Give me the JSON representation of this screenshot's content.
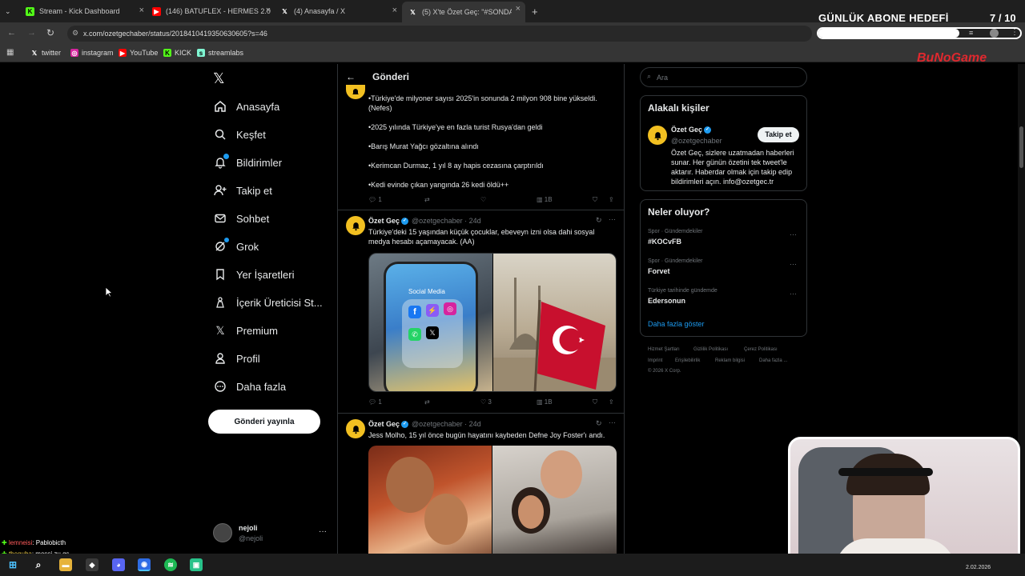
{
  "browser": {
    "tabs": [
      {
        "title": "Stream - Kick Dashboard",
        "icon": "kick-icon"
      },
      {
        "title": "(146) BATUFLEX - HERMES 2.0",
        "icon": "youtube-icon"
      },
      {
        "title": "(4) Anasayfa / X",
        "icon": "x-icon"
      },
      {
        "title": "(5) X'te Özet Geç: \"#SONDAKİK",
        "icon": "x-icon"
      }
    ],
    "url": "x.com/ozetgechaber/status/2018410419350630605?s=46",
    "bookmarks": [
      "twitter",
      "instagram",
      "YouTube",
      "KICK",
      "streamlabs"
    ]
  },
  "overlay": {
    "goal_title": "GÜNLÜK ABONE HEDEFİ",
    "goal_count": "7",
    "goal_total": "/ 10",
    "goal_progress": 0.7,
    "logo": "BuNoGame"
  },
  "nav": {
    "items": [
      "Anasayfa",
      "Keşfet",
      "Bildirimler",
      "Takip et",
      "Sohbet",
      "Grok",
      "Yer İşaretleri",
      "İçerik Üreticisi St...",
      "Premium",
      "Profil",
      "Daha fazla"
    ],
    "post_button": "Gönderi yayınla",
    "user_name": "nejoli",
    "user_handle": "@nejoli"
  },
  "main": {
    "title": "Gönderi",
    "tweet1": {
      "lines": [
        "•Türkiye'de milyoner sayısı 2025'in sonunda 2 milyon 908 bine yükseldi.",
        "(Nefes)",
        "•2025 yılında Türkiye'ye en fazla turist Rusya'dan geldi",
        "•Barış Murat Yağcı gözaltına alındı",
        "•Kerimcan Durmaz, 1 yıl 8 ay hapis cezasına çarptırıldı",
        "•Kedi evinde çıkan yangında 26 kedi öldü++"
      ],
      "replies": "1",
      "views": "1B"
    },
    "tweet2": {
      "name": "Özet Geç",
      "handle": "@ozetgechaber · 24d",
      "text_line1": "Türkiye'deki 15 yaşından küçük çocuklar, ebeveyn izni olsa dahi sosyal",
      "text_line2": "medya hesabı açamayacak. (AA)",
      "image_label": "Social Media",
      "replies": "1",
      "likes": "3",
      "views": "1B"
    },
    "tweet3": {
      "name": "Özet Geç",
      "handle": "@ozetgechaber · 24d",
      "text": "Jess Molho, 15 yıl önce bugün hayatını kaybeden Defne Joy Foster'ı andı."
    }
  },
  "sidebar": {
    "search_placeholder": "Ara",
    "related_title": "Alakalı kişiler",
    "related_name": "Özet Geç",
    "related_handle": "@ozetgechaber",
    "follow_button": "Takip et",
    "related_bio": [
      "Özet Geç, sizlere uzatmadan haberleri",
      "sunar. Her günün özetini tek tweet'le",
      "aktarır. Haberdar olmak için takip edip",
      "bildirimleri açın. info@ozetgec.tr"
    ],
    "trends_title": "Neler oluyor?",
    "trends": [
      {
        "category": "Spor · Gündemdekiler",
        "name": "#KOCvFB"
      },
      {
        "category": "Spor · Gündemdekiler",
        "name": "Forvet"
      },
      {
        "category": "Türkiye tarihinde gündemde",
        "name": "Edersonun"
      }
    ],
    "show_more": "Daha fazla göster",
    "footer": [
      "Hizmet Şartları",
      "Gizlilik Politikası",
      "Çerez Politikası",
      "Imprint",
      "Erişilebilirlik",
      "Reklam bilgisi",
      "Daha fazla ...",
      "© 2026 X Corp."
    ]
  },
  "chat": [
    {
      "user": "lemneisi",
      "msg": ": Pablobicth",
      "color": "#ff5b5b"
    },
    {
      "user": "theguba",
      "msg": ": messi zu gs",
      "color": "#f7d44c"
    }
  ],
  "taskbar": {
    "date": "2.02.2026"
  }
}
